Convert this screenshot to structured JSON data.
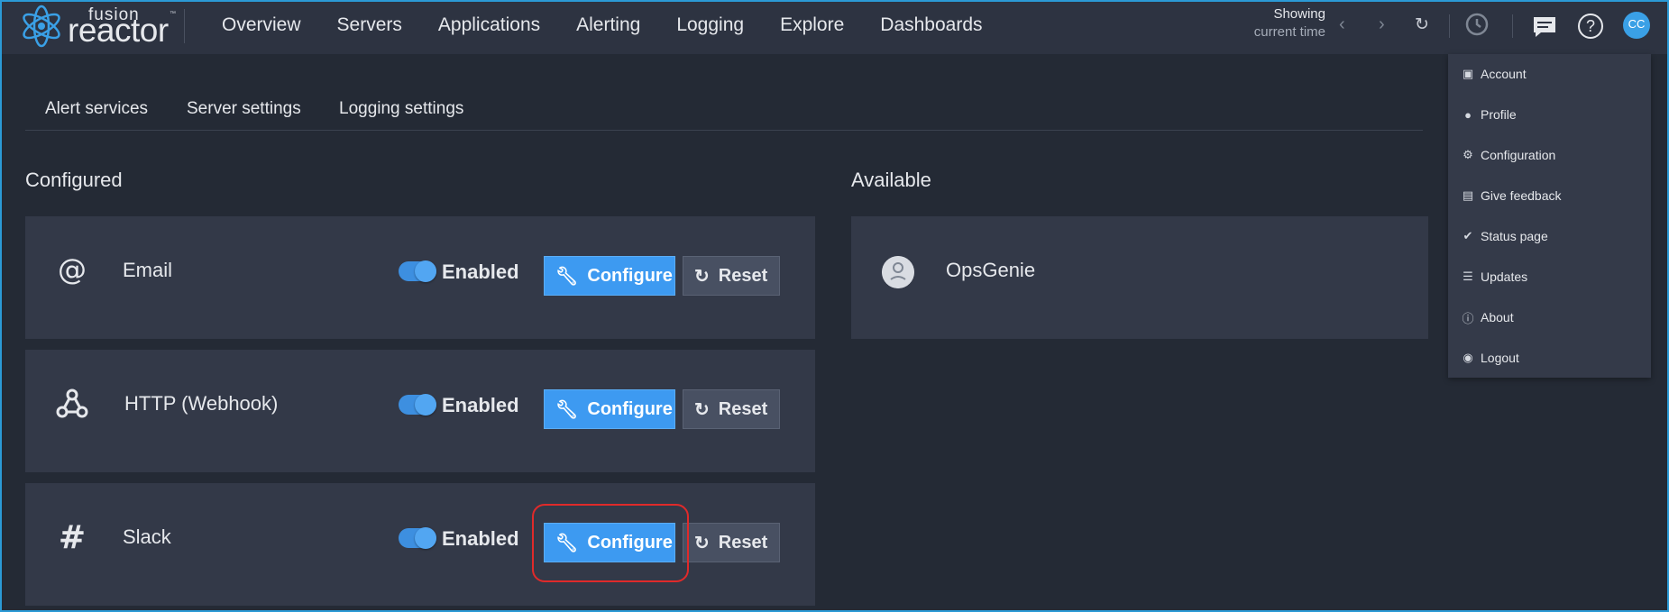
{
  "header": {
    "logo": {
      "small": "fusion",
      "large": "reactor",
      "tm": "™"
    },
    "nav": [
      "Overview",
      "Servers",
      "Applications",
      "Alerting",
      "Logging",
      "Explore",
      "Dashboards"
    ],
    "showing_label": "Showing",
    "showing_value": "current time",
    "avatar_initials": "CC"
  },
  "tabs": [
    "Alert services",
    "Server settings",
    "Logging settings"
  ],
  "configured": {
    "title": "Configured",
    "services": [
      {
        "name": "Email",
        "icon": "at-icon",
        "status": "Enabled",
        "configure": "Configure",
        "reset": "Reset"
      },
      {
        "name": "HTTP (Webhook)",
        "icon": "webhook-icon",
        "status": "Enabled",
        "configure": "Configure",
        "reset": "Reset"
      },
      {
        "name": "Slack",
        "icon": "slack-icon",
        "status": "Enabled",
        "configure": "Configure",
        "reset": "Reset"
      }
    ]
  },
  "available": {
    "title": "Available",
    "services": [
      {
        "name": "OpsGenie",
        "icon": "opsgenie-icon"
      }
    ]
  },
  "user_menu": {
    "items": [
      {
        "label": "Account",
        "icon": "cube-icon"
      },
      {
        "label": "Profile",
        "icon": "user-icon"
      },
      {
        "label": "Configuration",
        "icon": "gear-icon"
      },
      {
        "label": "Give feedback",
        "icon": "comment-icon"
      },
      {
        "label": "Status page",
        "icon": "check-icon"
      },
      {
        "label": "Updates",
        "icon": "list-icon"
      },
      {
        "label": "About",
        "icon": "question-icon"
      },
      {
        "label": "Logout",
        "icon": "logout-icon"
      }
    ]
  },
  "colors": {
    "accent": "#3d9af1",
    "background": "#242a35",
    "card": "#333948",
    "highlight": "#e02a2a"
  }
}
